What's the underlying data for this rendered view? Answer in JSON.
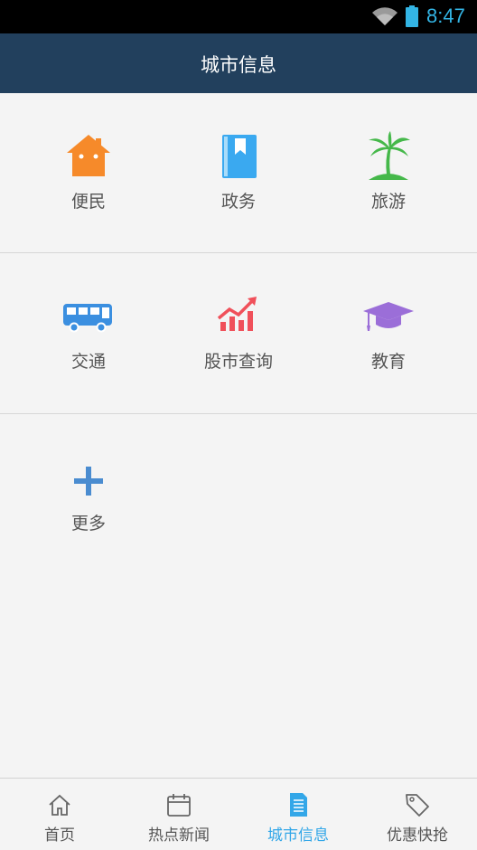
{
  "status_bar": {
    "time": "8:47",
    "wifi_icon": "wifi-icon",
    "battery_icon": "battery-icon"
  },
  "header": {
    "title": "城市信息"
  },
  "grid": [
    {
      "label": "便民",
      "icon": "house-icon",
      "color": "#f68a2a"
    },
    {
      "label": "政务",
      "icon": "book-icon",
      "color": "#3aa9f0"
    },
    {
      "label": "旅游",
      "icon": "palm-tree-icon",
      "color": "#45b84a"
    },
    {
      "label": "交通",
      "icon": "bus-icon",
      "color": "#3b8fe0"
    },
    {
      "label": "股市查询",
      "icon": "stock-chart-icon",
      "color": "#f0505a"
    },
    {
      "label": "教育",
      "icon": "graduation-cap-icon",
      "color": "#9b6ed8"
    },
    {
      "label": "更多",
      "icon": "plus-icon",
      "color": "#4a8cd0"
    }
  ],
  "tabs": [
    {
      "label": "首页",
      "icon": "home-icon",
      "active": false
    },
    {
      "label": "热点新闻",
      "icon": "calendar-icon",
      "active": false
    },
    {
      "label": "城市信息",
      "icon": "document-icon",
      "active": true
    },
    {
      "label": "优惠快抢",
      "icon": "tag-icon",
      "active": false
    }
  ],
  "colors": {
    "header_bg": "#22405d",
    "active_tab": "#33a7e8",
    "status_time": "#33b5e5"
  }
}
